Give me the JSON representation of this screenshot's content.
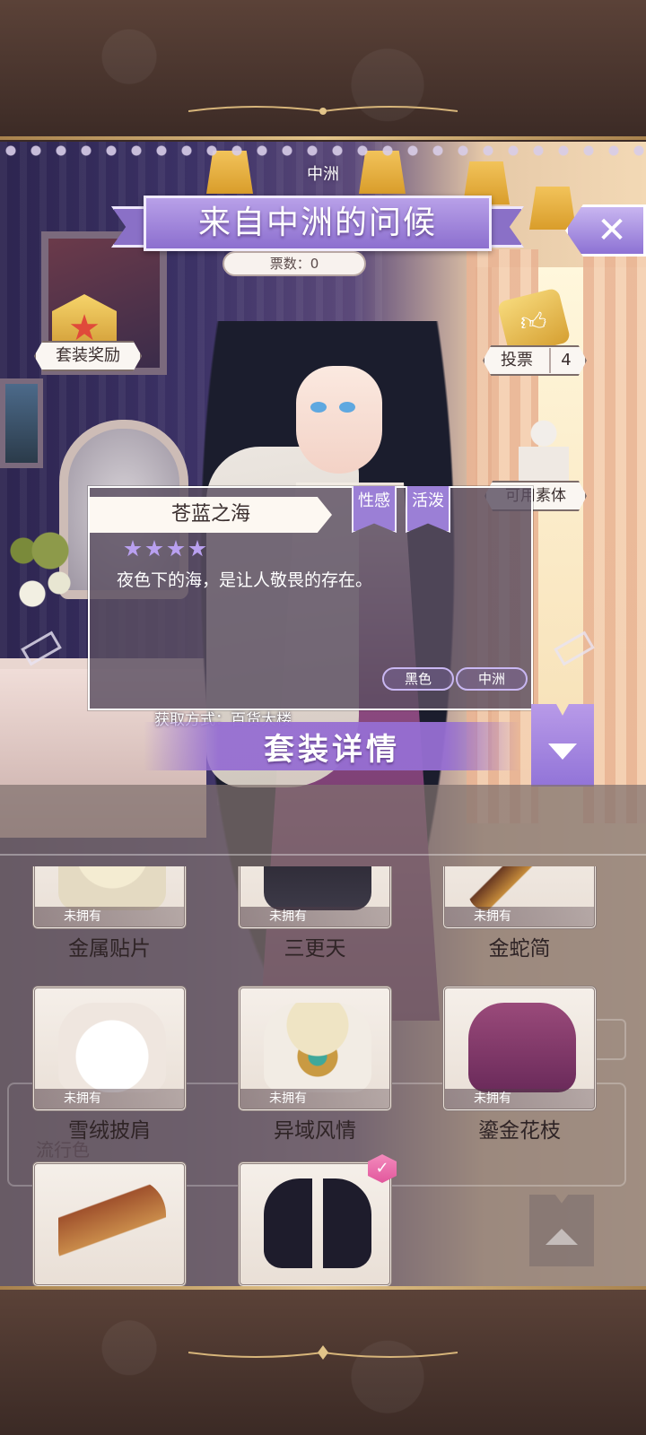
{
  "header": {
    "region": "中洲",
    "title": "来自中洲的问候",
    "votes_label": "票数：0"
  },
  "left_actions": {
    "set_reward_label": "套装奖励"
  },
  "right_actions": {
    "vote_label": "投票",
    "vote_count": "4",
    "mannequin_label": "可用素体"
  },
  "item_detail": {
    "name": "苍蓝之海",
    "tags": [
      "性感",
      "活泼"
    ],
    "stars": 4,
    "description": "夜色下的海，是让人敬畏的存在。",
    "attributes": [
      "黑色",
      "中洲"
    ],
    "acquire": "获取方式：百货大楼"
  },
  "section": {
    "title": "套装详情"
  },
  "background_text": "流行色",
  "items": [
    {
      "name": "金属贴片",
      "status": "未拥有"
    },
    {
      "name": "三更天",
      "status": "未拥有"
    },
    {
      "name": "金蛇简",
      "status": "未拥有"
    },
    {
      "name": "雪绒披肩",
      "status": "未拥有"
    },
    {
      "name": "异域风情",
      "status": "未拥有"
    },
    {
      "name": "鎏金花枝",
      "status": "未拥有"
    },
    {
      "name": "",
      "status": ""
    },
    {
      "name": "",
      "status": ""
    }
  ],
  "icons": {
    "close": "close-icon",
    "reward": "star-badge-icon",
    "vote": "thumbs-up-ticket-icon",
    "mannequin": "mannequin-icon",
    "expand": "chevron-down-icon",
    "collapse": "chevron-up-icon",
    "selected": "check-icon"
  },
  "colors": {
    "accent_purple": "#9b7fd6",
    "gold": "#e2c489",
    "star": "#b9a0f0",
    "badge_pink": "#e2579c"
  }
}
